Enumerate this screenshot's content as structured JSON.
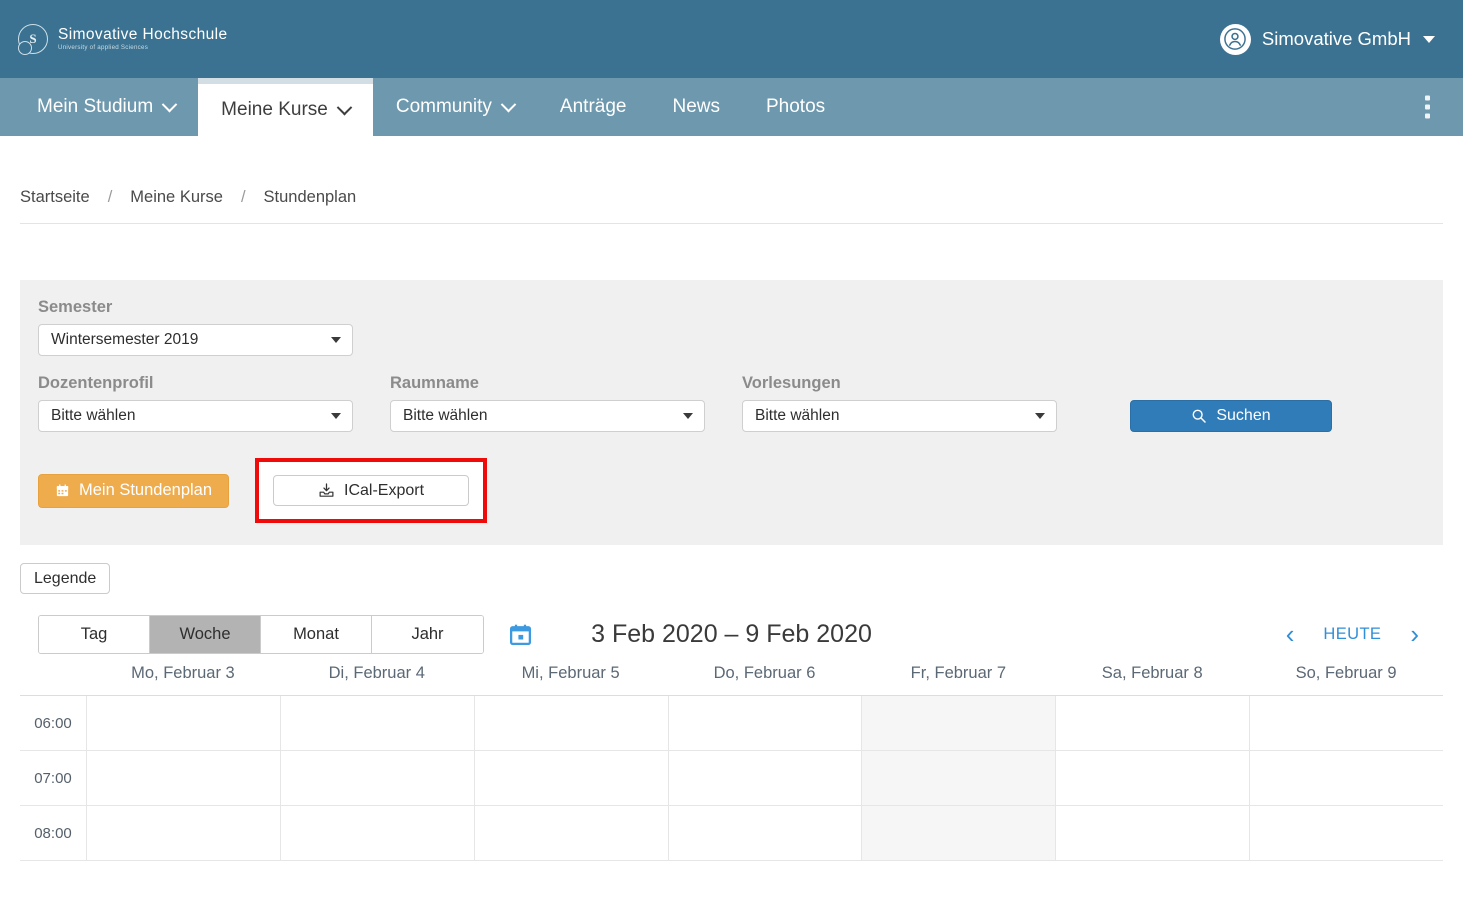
{
  "header": {
    "brand_title": "Simovative Hochschule",
    "brand_subtitle": "University of applied Sciences",
    "user_name": "Simovative GmbH",
    "avatar_icon": "user-icon",
    "caret_icon": "caret-down-icon",
    "bg_color": "#3b7291"
  },
  "nav": {
    "bg_color": "#6e98ad",
    "items": [
      {
        "label": "Mein Studium",
        "has_chevron": true,
        "active": false
      },
      {
        "label": "Meine Kurse",
        "has_chevron": true,
        "active": true
      },
      {
        "label": "Community",
        "has_chevron": true,
        "active": false
      },
      {
        "label": "Anträge",
        "has_chevron": false,
        "active": false
      },
      {
        "label": "News",
        "has_chevron": false,
        "active": false
      },
      {
        "label": "Photos",
        "has_chevron": false,
        "active": false
      }
    ],
    "overflow_icon": "kebab-menu-icon"
  },
  "breadcrumb": {
    "items": [
      "Startseite",
      "Meine Kurse",
      "Stundenplan"
    ],
    "separator": "/"
  },
  "filters": {
    "semester": {
      "label": "Semester",
      "value": "Wintersemester 2019"
    },
    "dozentenprofil": {
      "label": "Dozentenprofil",
      "value": "Bitte wählen"
    },
    "raumname": {
      "label": "Raumname",
      "value": "Bitte wählen"
    },
    "vorlesungen": {
      "label": "Vorlesungen",
      "value": "Bitte wählen"
    },
    "search_button": {
      "label": "Suchen",
      "icon": "search-icon",
      "color": "#2f7cb8"
    },
    "my_schedule_button": {
      "label": "Mein Stundenplan",
      "icon": "calendar-icon",
      "color": "#eeac4d"
    },
    "ical_export_button": {
      "label": "ICal-Export",
      "icon": "download-inbox-icon"
    },
    "highlight_color": "#f00b0b"
  },
  "calendar": {
    "legend_button": "Legende",
    "views": [
      {
        "label": "Tag",
        "active": false
      },
      {
        "label": "Woche",
        "active": true
      },
      {
        "label": "Monat",
        "active": false
      },
      {
        "label": "Jahr",
        "active": false
      }
    ],
    "datepicker_icon": "calendar-picker-icon",
    "date_range": "3 Feb 2020 – 9 Feb 2020",
    "prev_icon": "chevron-left-icon",
    "next_icon": "chevron-right-icon",
    "prev_glyph": "‹",
    "next_glyph": "›",
    "today_label": "HEUTE",
    "accent_color": "#2f8fd8",
    "days": [
      {
        "label": "Mo, Februar 3",
        "today": false
      },
      {
        "label": "Di, Februar 4",
        "today": false
      },
      {
        "label": "Mi, Februar 5",
        "today": false
      },
      {
        "label": "Do, Februar 6",
        "today": false
      },
      {
        "label": "Fr, Februar 7",
        "today": true
      },
      {
        "label": "Sa, Februar 8",
        "today": false
      },
      {
        "label": "So, Februar 9",
        "today": false
      }
    ],
    "times": [
      "06:00",
      "07:00",
      "08:00"
    ]
  }
}
